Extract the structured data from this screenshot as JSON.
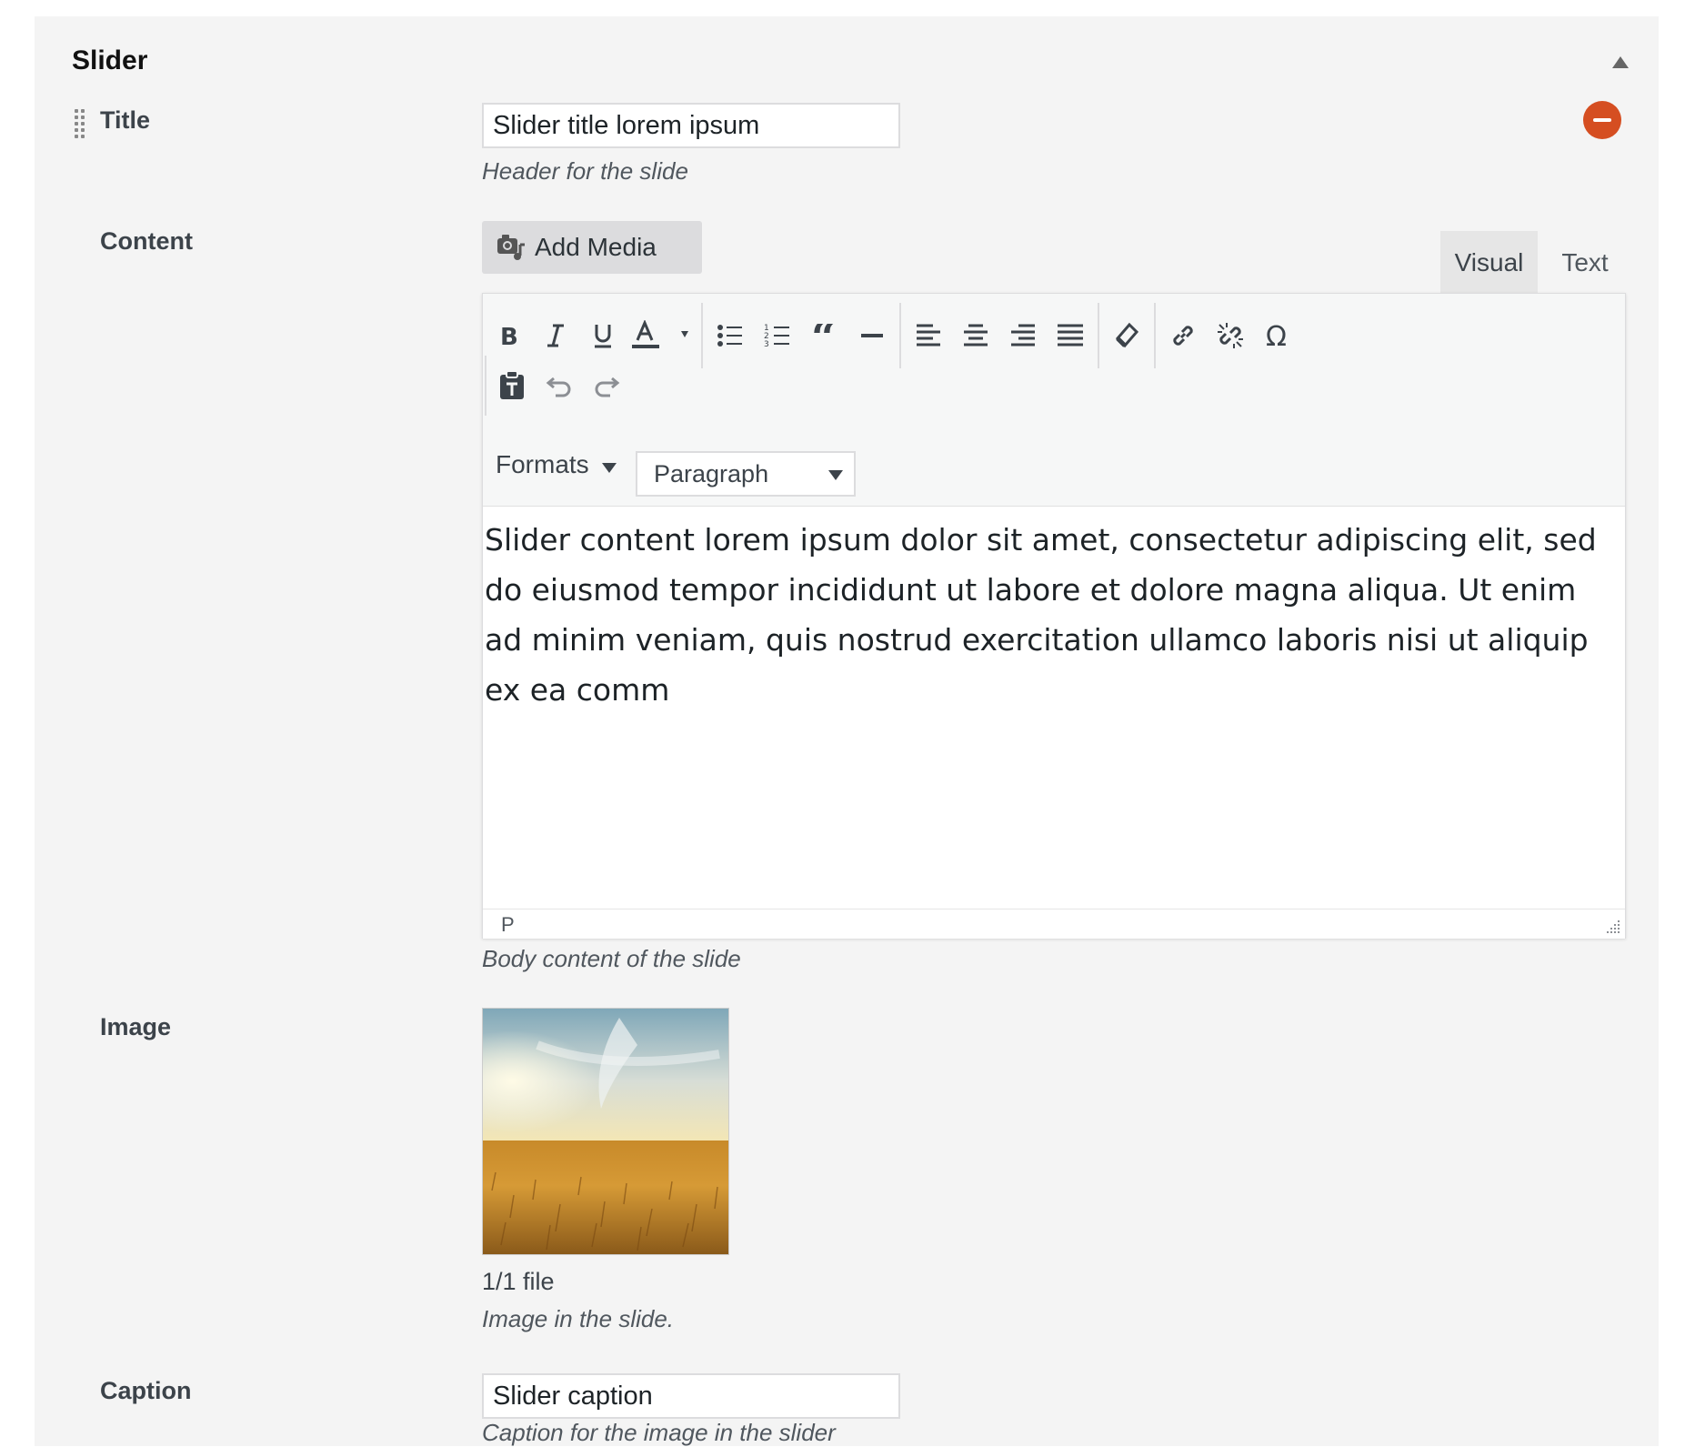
{
  "panel": {
    "title": "Slider"
  },
  "fields": {
    "title": {
      "label": "Title",
      "value": "Slider title lorem ipsum",
      "description": "Header for the slide"
    },
    "content": {
      "label": "Content",
      "add_media_label": "Add Media",
      "tabs": [
        "Visual",
        "Text"
      ],
      "active_tab": "Visual",
      "formats_label": "Formats",
      "block_format": "Paragraph",
      "body_text": "Slider content lorem ipsum dolor sit amet, consectetur adipiscing elit, sed do eiusmod tempor incididunt ut labore et dolore magna aliqua. Ut enim ad minim veniam, quis nostrud exercitation ullamco laboris nisi ut aliquip ex ea comm",
      "status_path": "P",
      "description": "Body content of the slide"
    },
    "image": {
      "label": "Image",
      "file_count": "1/1 file",
      "description": "Image in the slide."
    },
    "caption": {
      "label": "Caption",
      "value": "Slider caption",
      "description": "Caption for the image in the slider"
    }
  },
  "toolbar": {
    "row1": [
      "bold-icon",
      "italic-icon",
      "underline-icon",
      "text-color-icon",
      "bulleted-list-icon",
      "numbered-list-icon",
      "blockquote-icon",
      "horizontal-line-icon",
      "align-left-icon",
      "align-center-icon",
      "align-right-icon",
      "justify-icon",
      "clear-formatting-icon",
      "insert-link-icon",
      "remove-link-icon",
      "special-character-icon"
    ],
    "row2": [
      "paste-as-text-icon",
      "undo-icon",
      "redo-icon"
    ]
  },
  "colors": {
    "panel_bg": "#f4f4f4",
    "remove_button": "#d54e21",
    "spellcheck_underline": "#d63638"
  }
}
